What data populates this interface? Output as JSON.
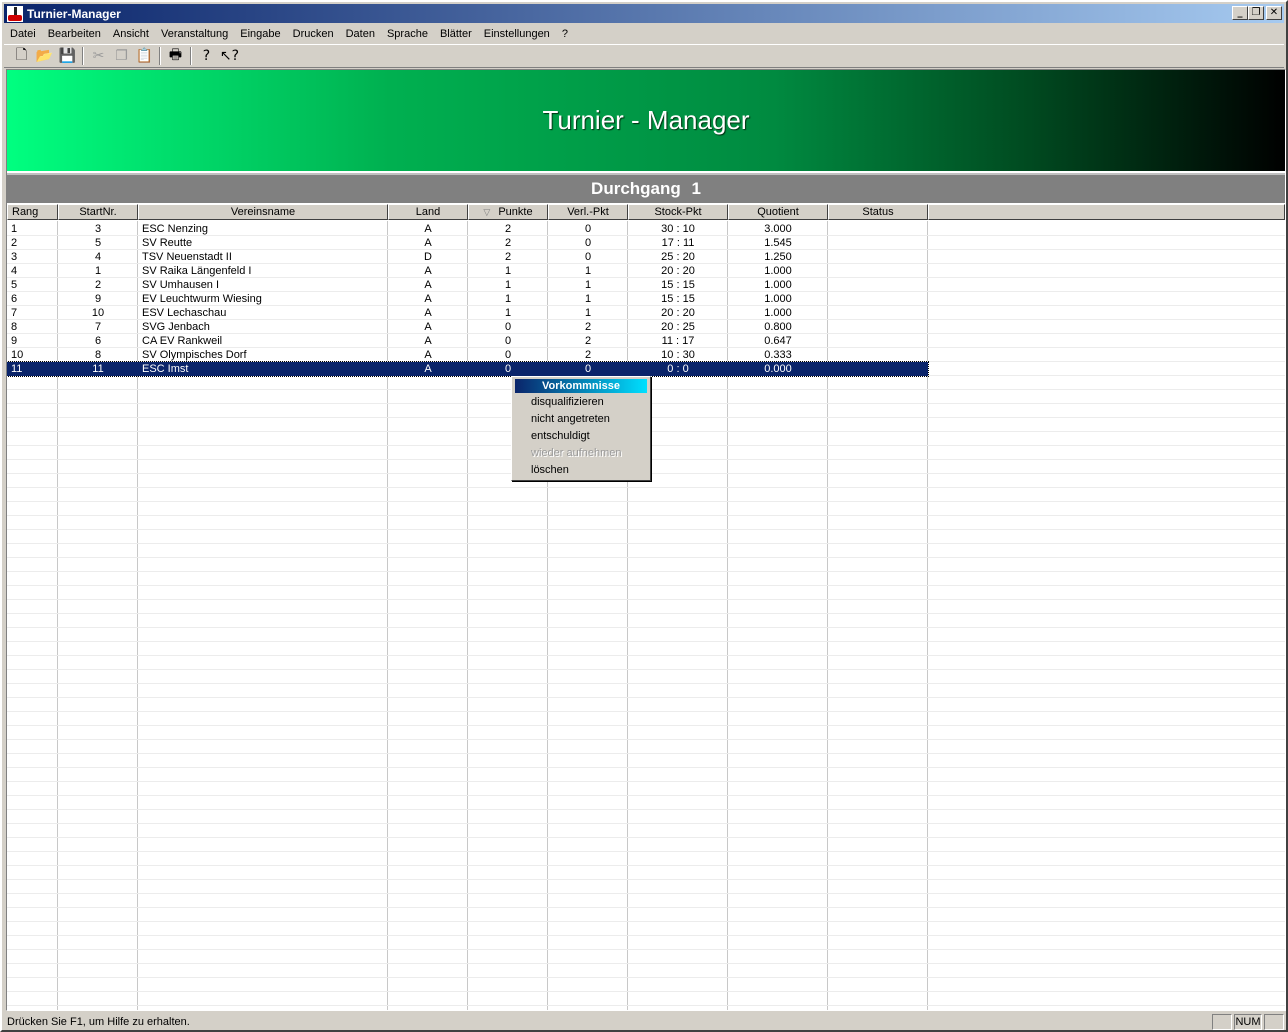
{
  "window": {
    "title": "Turnier-Manager"
  },
  "menubar": [
    "Datei",
    "Bearbeiten",
    "Ansicht",
    "Veranstaltung",
    "Eingabe",
    "Drucken",
    "Daten",
    "Sprache",
    "Blätter",
    "Einstellungen",
    "?"
  ],
  "toolbar": {
    "buttons": [
      {
        "name": "new-document-icon",
        "glyph": "🗋",
        "enabled": true
      },
      {
        "name": "open-folder-icon",
        "glyph": "📂",
        "enabled": true
      },
      {
        "name": "save-icon",
        "glyph": "💾",
        "enabled": true
      },
      {
        "name": "cut-icon",
        "glyph": "✂",
        "enabled": false
      },
      {
        "name": "copy-icon",
        "glyph": "❐",
        "enabled": false
      },
      {
        "name": "paste-icon",
        "glyph": "📋",
        "enabled": false
      },
      {
        "name": "print-icon",
        "glyph": "🖶",
        "enabled": true
      },
      {
        "name": "help-icon",
        "glyph": "?",
        "enabled": true
      },
      {
        "name": "context-help-icon",
        "glyph": "↖?",
        "enabled": true
      }
    ]
  },
  "banner": {
    "title": "Turnier - Manager"
  },
  "section": {
    "title": "Durchgang  1"
  },
  "table": {
    "columns": [
      "Rang",
      "StartNr.",
      "Vereinsname",
      "Land",
      "Punkte",
      "Verl.-Pkt",
      "Stock-Pkt",
      "Quotient",
      "Status"
    ],
    "sort_column": "Punkte",
    "rows": [
      [
        "1",
        "3",
        "ESC Nenzing",
        "A",
        "2",
        "0",
        "30 : 10",
        "3.000",
        ""
      ],
      [
        "2",
        "5",
        "SV Reutte",
        "A",
        "2",
        "0",
        "17 : 11",
        "1.545",
        ""
      ],
      [
        "3",
        "4",
        "TSV Neuenstadt II",
        "D",
        "2",
        "0",
        "25 : 20",
        "1.250",
        ""
      ],
      [
        "4",
        "1",
        "SV Raika Längenfeld I",
        "A",
        "1",
        "1",
        "20 : 20",
        "1.000",
        ""
      ],
      [
        "5",
        "2",
        "SV Umhausen I",
        "A",
        "1",
        "1",
        "15 : 15",
        "1.000",
        ""
      ],
      [
        "6",
        "9",
        "EV Leuchtwurm Wiesing",
        "A",
        "1",
        "1",
        "15 : 15",
        "1.000",
        ""
      ],
      [
        "7",
        "10",
        "ESV Lechaschau",
        "A",
        "1",
        "1",
        "20 : 20",
        "1.000",
        ""
      ],
      [
        "8",
        "7",
        "SVG Jenbach",
        "A",
        "0",
        "2",
        "20 : 25",
        "0.800",
        ""
      ],
      [
        "9",
        "6",
        "CA EV Rankweil",
        "A",
        "0",
        "2",
        "11 : 17",
        "0.647",
        ""
      ],
      [
        "10",
        "8",
        "SV Olympisches Dorf",
        "A",
        "0",
        "2",
        "10 : 30",
        "0.333",
        ""
      ],
      [
        "11",
        "11",
        "ESC Imst",
        "A",
        "0",
        "0",
        "0 : 0",
        "0.000",
        ""
      ]
    ],
    "selected_row": 10
  },
  "context_menu": {
    "title": "Vorkommnisse",
    "items": [
      {
        "label": "disqualifizieren",
        "enabled": true
      },
      {
        "label": "nicht angetreten",
        "enabled": true
      },
      {
        "label": "entschuldigt",
        "enabled": true
      },
      {
        "label": "wieder aufnehmen",
        "enabled": false
      },
      {
        "label": "löschen",
        "enabled": true
      }
    ]
  },
  "statusbar": {
    "text": "Drücken Sie F1, um Hilfe zu erhalten.",
    "num": "NUM"
  },
  "colors": {
    "selection": "#0a246a",
    "titlebar": "#0a246a",
    "banner_start": "#00ff80",
    "banner_end": "#000000",
    "section_bar": "#808080"
  }
}
